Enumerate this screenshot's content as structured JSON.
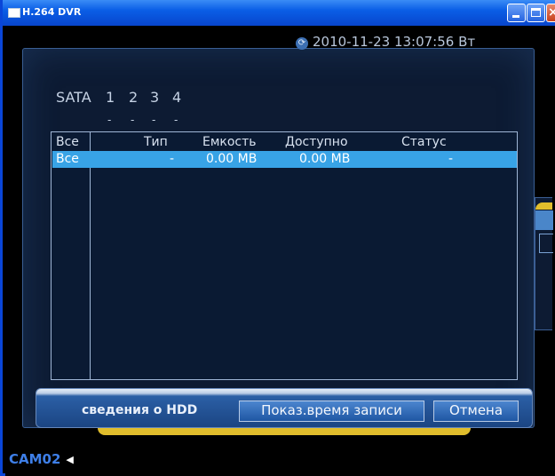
{
  "window": {
    "title": "H.264 DVR"
  },
  "datetime": "2010-11-23 13:07:56 Вт",
  "sata": {
    "label": "SATA",
    "ports": [
      "1",
      "2",
      "3",
      "4"
    ],
    "status": [
      "-",
      "-",
      "-",
      "-"
    ]
  },
  "table": {
    "header": {
      "all": "Все",
      "type": "Тип",
      "capacity": "Емкость",
      "available": "Доступно",
      "status": "Статус"
    },
    "rows": [
      {
        "all": "Все",
        "type": "-",
        "capacity": "0.00 MB",
        "available": "0.00 MB",
        "status": "-"
      }
    ]
  },
  "footer": {
    "hdd_info_label": "сведения о HDD",
    "show_record_time_label": "Показ.время записи",
    "cancel_label": "Отмена"
  },
  "camera": {
    "label": "CAM02"
  },
  "colors": {
    "selected_row": "#38a3e6",
    "camera_label": "#3e7fe8",
    "accent_yellow": "#e0bd2c"
  }
}
